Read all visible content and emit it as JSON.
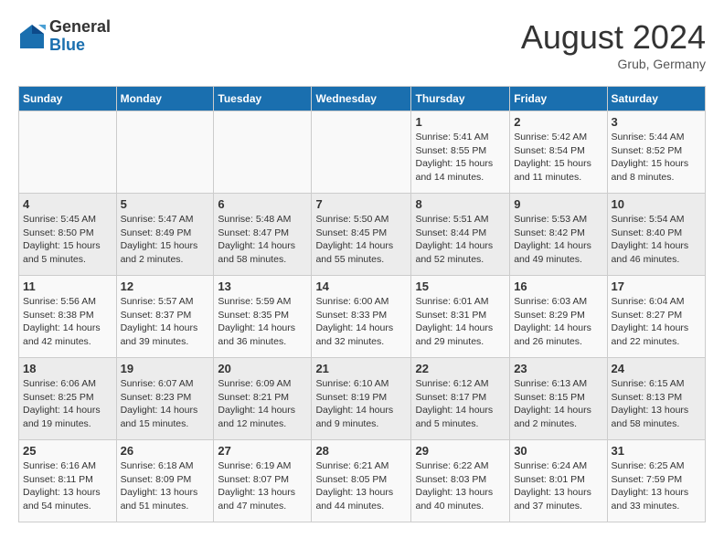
{
  "header": {
    "logo_general": "General",
    "logo_blue": "Blue",
    "month_year": "August 2024",
    "location": "Grub, Germany"
  },
  "days_of_week": [
    "Sunday",
    "Monday",
    "Tuesday",
    "Wednesday",
    "Thursday",
    "Friday",
    "Saturday"
  ],
  "weeks": [
    [
      {
        "day": "",
        "detail": ""
      },
      {
        "day": "",
        "detail": ""
      },
      {
        "day": "",
        "detail": ""
      },
      {
        "day": "",
        "detail": ""
      },
      {
        "day": "1",
        "detail": "Sunrise: 5:41 AM\nSunset: 8:55 PM\nDaylight: 15 hours\nand 14 minutes."
      },
      {
        "day": "2",
        "detail": "Sunrise: 5:42 AM\nSunset: 8:54 PM\nDaylight: 15 hours\nand 11 minutes."
      },
      {
        "day": "3",
        "detail": "Sunrise: 5:44 AM\nSunset: 8:52 PM\nDaylight: 15 hours\nand 8 minutes."
      }
    ],
    [
      {
        "day": "4",
        "detail": "Sunrise: 5:45 AM\nSunset: 8:50 PM\nDaylight: 15 hours\nand 5 minutes."
      },
      {
        "day": "5",
        "detail": "Sunrise: 5:47 AM\nSunset: 8:49 PM\nDaylight: 15 hours\nand 2 minutes."
      },
      {
        "day": "6",
        "detail": "Sunrise: 5:48 AM\nSunset: 8:47 PM\nDaylight: 14 hours\nand 58 minutes."
      },
      {
        "day": "7",
        "detail": "Sunrise: 5:50 AM\nSunset: 8:45 PM\nDaylight: 14 hours\nand 55 minutes."
      },
      {
        "day": "8",
        "detail": "Sunrise: 5:51 AM\nSunset: 8:44 PM\nDaylight: 14 hours\nand 52 minutes."
      },
      {
        "day": "9",
        "detail": "Sunrise: 5:53 AM\nSunset: 8:42 PM\nDaylight: 14 hours\nand 49 minutes."
      },
      {
        "day": "10",
        "detail": "Sunrise: 5:54 AM\nSunset: 8:40 PM\nDaylight: 14 hours\nand 46 minutes."
      }
    ],
    [
      {
        "day": "11",
        "detail": "Sunrise: 5:56 AM\nSunset: 8:38 PM\nDaylight: 14 hours\nand 42 minutes."
      },
      {
        "day": "12",
        "detail": "Sunrise: 5:57 AM\nSunset: 8:37 PM\nDaylight: 14 hours\nand 39 minutes."
      },
      {
        "day": "13",
        "detail": "Sunrise: 5:59 AM\nSunset: 8:35 PM\nDaylight: 14 hours\nand 36 minutes."
      },
      {
        "day": "14",
        "detail": "Sunrise: 6:00 AM\nSunset: 8:33 PM\nDaylight: 14 hours\nand 32 minutes."
      },
      {
        "day": "15",
        "detail": "Sunrise: 6:01 AM\nSunset: 8:31 PM\nDaylight: 14 hours\nand 29 minutes."
      },
      {
        "day": "16",
        "detail": "Sunrise: 6:03 AM\nSunset: 8:29 PM\nDaylight: 14 hours\nand 26 minutes."
      },
      {
        "day": "17",
        "detail": "Sunrise: 6:04 AM\nSunset: 8:27 PM\nDaylight: 14 hours\nand 22 minutes."
      }
    ],
    [
      {
        "day": "18",
        "detail": "Sunrise: 6:06 AM\nSunset: 8:25 PM\nDaylight: 14 hours\nand 19 minutes."
      },
      {
        "day": "19",
        "detail": "Sunrise: 6:07 AM\nSunset: 8:23 PM\nDaylight: 14 hours\nand 15 minutes."
      },
      {
        "day": "20",
        "detail": "Sunrise: 6:09 AM\nSunset: 8:21 PM\nDaylight: 14 hours\nand 12 minutes."
      },
      {
        "day": "21",
        "detail": "Sunrise: 6:10 AM\nSunset: 8:19 PM\nDaylight: 14 hours\nand 9 minutes."
      },
      {
        "day": "22",
        "detail": "Sunrise: 6:12 AM\nSunset: 8:17 PM\nDaylight: 14 hours\nand 5 minutes."
      },
      {
        "day": "23",
        "detail": "Sunrise: 6:13 AM\nSunset: 8:15 PM\nDaylight: 14 hours\nand 2 minutes."
      },
      {
        "day": "24",
        "detail": "Sunrise: 6:15 AM\nSunset: 8:13 PM\nDaylight: 13 hours\nand 58 minutes."
      }
    ],
    [
      {
        "day": "25",
        "detail": "Sunrise: 6:16 AM\nSunset: 8:11 PM\nDaylight: 13 hours\nand 54 minutes."
      },
      {
        "day": "26",
        "detail": "Sunrise: 6:18 AM\nSunset: 8:09 PM\nDaylight: 13 hours\nand 51 minutes."
      },
      {
        "day": "27",
        "detail": "Sunrise: 6:19 AM\nSunset: 8:07 PM\nDaylight: 13 hours\nand 47 minutes."
      },
      {
        "day": "28",
        "detail": "Sunrise: 6:21 AM\nSunset: 8:05 PM\nDaylight: 13 hours\nand 44 minutes."
      },
      {
        "day": "29",
        "detail": "Sunrise: 6:22 AM\nSunset: 8:03 PM\nDaylight: 13 hours\nand 40 minutes."
      },
      {
        "day": "30",
        "detail": "Sunrise: 6:24 AM\nSunset: 8:01 PM\nDaylight: 13 hours\nand 37 minutes."
      },
      {
        "day": "31",
        "detail": "Sunrise: 6:25 AM\nSunset: 7:59 PM\nDaylight: 13 hours\nand 33 minutes."
      }
    ]
  ]
}
